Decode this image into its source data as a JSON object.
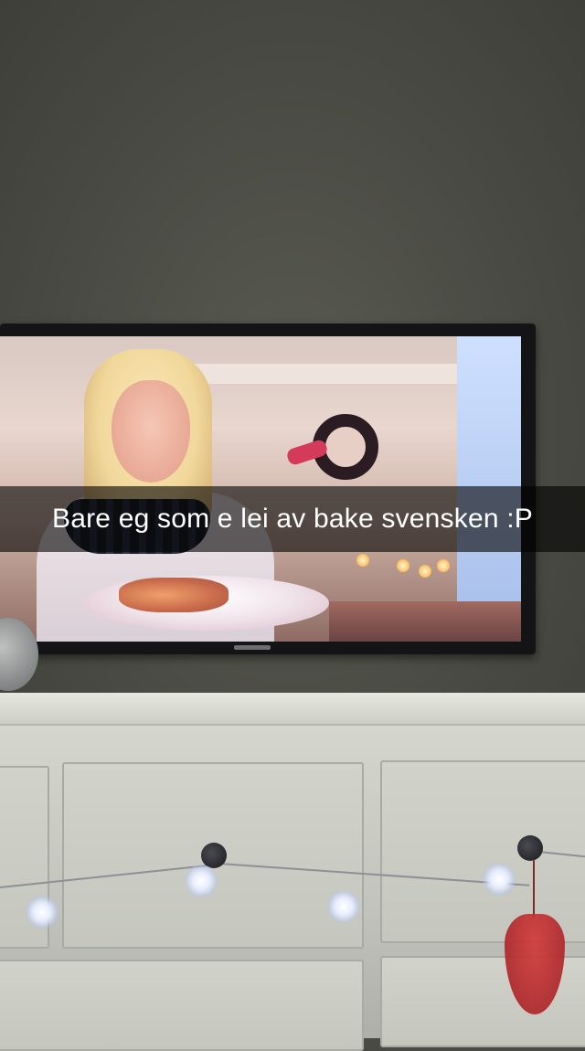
{
  "snap": {
    "caption": "Bare eg som e lei av bake svensken :P"
  },
  "colors": {
    "caption_bar": "#000000",
    "caption_text": "#ffffff",
    "wall": "#4a4b44",
    "cabinet": "#c8c9c1"
  }
}
